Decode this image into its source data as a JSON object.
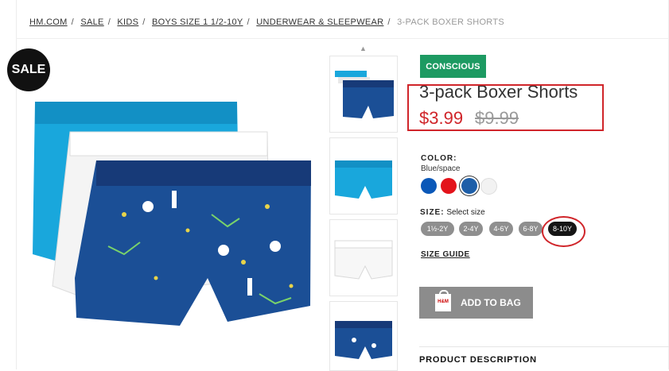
{
  "breadcrumb": {
    "items": [
      "HM.COM",
      "SALE",
      "KIDS",
      "BOYS SIZE 1 1/2-10Y",
      "UNDERWEAR & SLEEPWEAR"
    ],
    "current": "3-PACK BOXER SHORTS"
  },
  "badge": {
    "sale": "SALE"
  },
  "product": {
    "tag": "CONSCIOUS",
    "title": "3-pack Boxer Shorts",
    "price_now": "$3.99",
    "price_was": "$9.99"
  },
  "color": {
    "label": "COLOR:",
    "value": "Blue/space",
    "swatches": [
      "#0b58b8",
      "#e3131b",
      "#1d5ea8",
      "#f2f2f2"
    ]
  },
  "size": {
    "label": "SIZE:",
    "hint": "Select size",
    "options": [
      "1½-2Y",
      "2-4Y",
      "4-6Y",
      "6-8Y",
      "8-10Y"
    ],
    "selected": "8-10Y"
  },
  "size_guide": "SIZE GUIDE",
  "add_to_bag": "ADD TO BAG",
  "bag_brand": "H&M",
  "product_description": "PRODUCT DESCRIPTION",
  "colors": {
    "accent_red": "#d0252a",
    "conscious_green": "#1d9a62"
  }
}
